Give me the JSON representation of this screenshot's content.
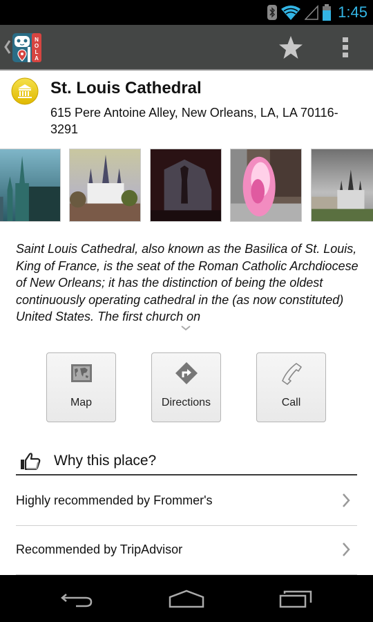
{
  "status_bar": {
    "time": "1:45",
    "icons": [
      "bluetooth-icon",
      "wifi-icon",
      "signal-icon",
      "battery-icon"
    ],
    "accent_color": "#33b5e5"
  },
  "action_bar": {
    "app_name": "NOLA",
    "actions": [
      "star-icon",
      "overflow-menu-icon"
    ]
  },
  "place": {
    "category_icon": "museum-icon",
    "title": "St. Louis Cathedral",
    "address": "615 Pere Antoine Alley, New Orleans, LA, LA 70116-3291"
  },
  "photos": [
    {
      "alt": "Cathedral spires against teal sky"
    },
    {
      "alt": "Cathedral front with crowd in square"
    },
    {
      "alt": "Shadow of statue on cathedral wall at night"
    },
    {
      "alt": "Mardi Gras Indian pink feathered costume"
    },
    {
      "alt": "Cathedral under cloudy grey sky"
    }
  ],
  "description": "Saint Louis Cathedral, also known as the Basilica of St. Louis, King of France, is the seat of the Roman Catholic Archdiocese of New Orleans; it has the distinction of being the oldest continuously operating cathedral in the (as now constituted) United States. The first church on",
  "actions": [
    {
      "label": "Map",
      "icon": "map-icon"
    },
    {
      "label": "Directions",
      "icon": "directions-icon"
    },
    {
      "label": "Call",
      "icon": "phone-icon"
    }
  ],
  "why_section": {
    "title": "Why this place?",
    "icon": "thumbs-up-icon",
    "items": [
      {
        "label": "Highly recommended by Frommer's"
      },
      {
        "label": "Recommended by TripAdvisor"
      }
    ]
  },
  "nav_bar": {
    "buttons": [
      "back-icon",
      "home-icon",
      "recents-icon"
    ]
  }
}
